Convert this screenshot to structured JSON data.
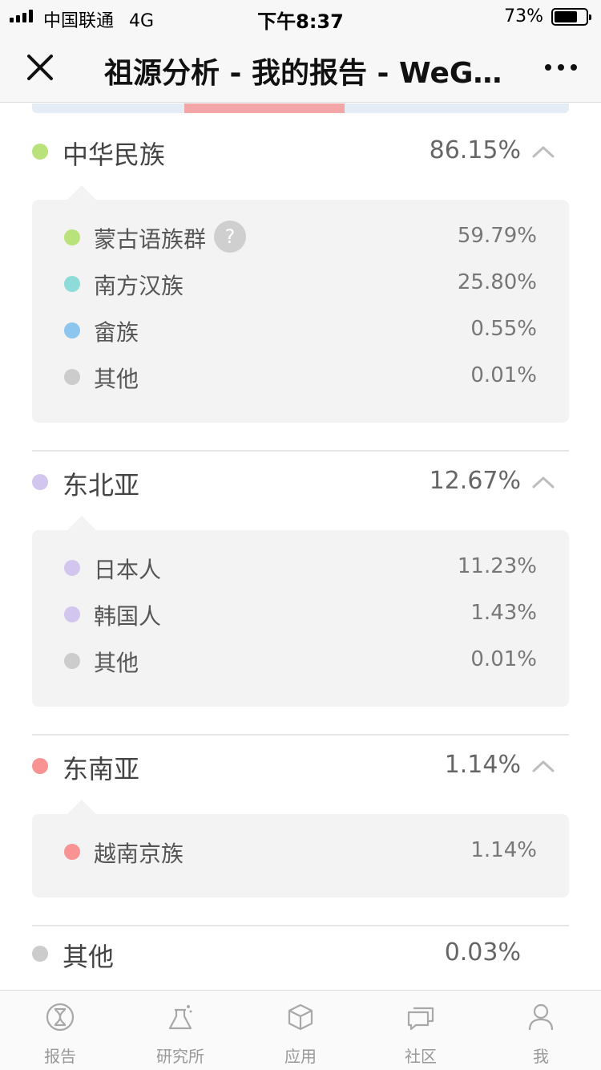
{
  "status_bar": {
    "carrier": "中国联通",
    "network": "4G",
    "time": "下午8:37",
    "battery": "73%",
    "battery_level": 0.73
  },
  "nav": {
    "title": "祖源分析 - 我的报告 - WeG..."
  },
  "groups": [
    {
      "name": "中华民族",
      "percent": "86.15%",
      "color": "#b9e27a",
      "expanded": true,
      "items": [
        {
          "name": "蒙古语族群",
          "percent": "59.79%",
          "color": "#b9e27a",
          "help_icon": "?"
        },
        {
          "name": "南方汉族",
          "percent": "25.80%",
          "color": "#8ddcd9"
        },
        {
          "name": "畲族",
          "percent": "0.55%",
          "color": "#8cc6ee"
        },
        {
          "name": "其他",
          "percent": "0.01%",
          "color": "#cccccc"
        }
      ]
    },
    {
      "name": "东北亚",
      "percent": "12.67%",
      "color": "#d3c6ee",
      "expanded": true,
      "items": [
        {
          "name": "日本人",
          "percent": "11.23%",
          "color": "#d3c6ee"
        },
        {
          "name": "韩国人",
          "percent": "1.43%",
          "color": "#d3c6ee"
        },
        {
          "name": "其他",
          "percent": "0.01%",
          "color": "#cccccc"
        }
      ]
    },
    {
      "name": "东南亚",
      "percent": "1.14%",
      "color": "#f99393",
      "expanded": true,
      "items": [
        {
          "name": "越南京族",
          "percent": "1.14%",
          "color": "#f99393"
        }
      ]
    },
    {
      "name": "其他",
      "percent": "0.03%",
      "color": "#cccccc",
      "expanded": false,
      "items": []
    }
  ],
  "tabs": [
    {
      "label": "报告",
      "icon": "dna-icon"
    },
    {
      "label": "研究所",
      "icon": "flask-icon"
    },
    {
      "label": "应用",
      "icon": "cube-icon"
    },
    {
      "label": "社区",
      "icon": "chat-icon"
    },
    {
      "label": "我",
      "icon": "user-icon"
    }
  ]
}
